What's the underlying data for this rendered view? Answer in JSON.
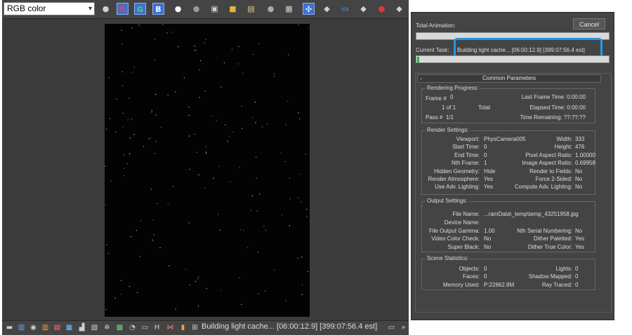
{
  "frame_buffer": {
    "channel_select": "RGB color",
    "toolbar": {
      "r_label": "R",
      "g_label": "G",
      "b_label": "B"
    },
    "status": "Building light cache... [06:00:12.9] [399:07:56.4 est]"
  },
  "dialog": {
    "total_animation_label": "Total Animation:",
    "cancel_label": "Cancel",
    "current_task_label": "Current Task:",
    "current_task_value": "Building light cache... [06:00:12.9] [399:07:56.4 est]",
    "task_progress_fraction": 0.01,
    "common_parameters": "Common Parameters",
    "rendering_progress": {
      "title": "Rendering Progress:",
      "frame_label": "Frame #",
      "frame_value": "0",
      "frame_count": "1 of 1",
      "total_label": "Total",
      "pass_label": "Pass #",
      "pass_value": "1/1",
      "last_frame_time": "Last Frame Time:  0:00:00",
      "elapsed_time": "Elapsed Time:  0:00:00",
      "time_remaining": "Time Remaining:  ??:??:??"
    },
    "render_settings": {
      "title": "Render Settings:",
      "left": [
        {
          "k": "Viewport:",
          "v": "PhysCamera005"
        },
        {
          "k": "Start Time:",
          "v": "0"
        },
        {
          "k": "End Time:",
          "v": "0"
        },
        {
          "k": "Nth Frame:",
          "v": "1"
        },
        {
          "k": "Hidden Geometry:",
          "v": "Hide"
        },
        {
          "k": "Render Atmosphere:",
          "v": "Yes"
        },
        {
          "k": "Use Adv. Lighting:",
          "v": "Yes"
        }
      ],
      "right": [
        {
          "k": "Width:",
          "v": "333"
        },
        {
          "k": "Height:",
          "v": "476"
        },
        {
          "k": "Pixel Aspect Ratio:",
          "v": "1.00000"
        },
        {
          "k": "Image Aspect Ratio:",
          "v": "0.69958"
        },
        {
          "k": "Render to Fields:",
          "v": "No"
        },
        {
          "k": "Force 2-Sided:",
          "v": "No"
        },
        {
          "k": "Compute Adv. Lighting:",
          "v": "No"
        }
      ]
    },
    "output_settings": {
      "title": "Output Settings:",
      "file_name_label": "File Name:",
      "file_name": "...ramData\\_temp\\temp_43251958.jpg",
      "device_name_label": "Device Name:",
      "left": [
        {
          "k": "File Output Gamma:",
          "v": "1.00"
        },
        {
          "k": "Video Color Check:",
          "v": "No"
        },
        {
          "k": "Super Black:",
          "v": "No"
        }
      ],
      "right": [
        {
          "k": "Nth Serial Numbering:",
          "v": "No"
        },
        {
          "k": "Dither Paletted:",
          "v": "Yes"
        },
        {
          "k": "Dither True Color:",
          "v": "Yes"
        }
      ]
    },
    "scene_statistics": {
      "title": "Scene Statistics:",
      "left": [
        {
          "k": "Objects:",
          "v": "0"
        },
        {
          "k": "Faces:",
          "v": "0"
        },
        {
          "k": "Memory Used:",
          "v": "P:22662.8M"
        }
      ],
      "right": [
        {
          "k": "Lights:",
          "v": "0"
        },
        {
          "k": "Shadow Mapped:",
          "v": "0"
        },
        {
          "k": "Ray Traced:",
          "v": "0"
        }
      ]
    }
  }
}
